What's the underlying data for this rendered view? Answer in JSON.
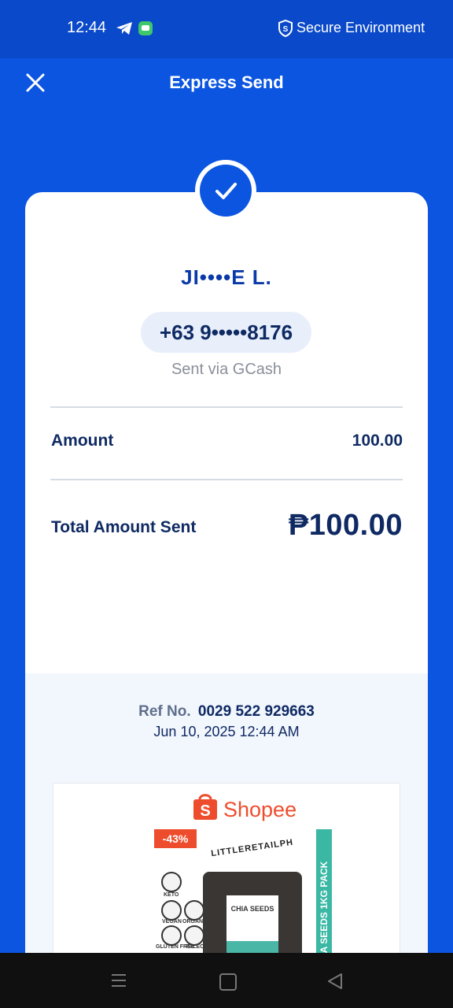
{
  "status_bar": {
    "time": "12:44",
    "secure_text": "Secure Environment"
  },
  "header": {
    "title": "Express Send"
  },
  "receipt": {
    "recipient_name": "JI••••E L.",
    "phone": "+63 9•••••8176",
    "sent_via": "Sent via GCash",
    "amount_label": "Amount",
    "amount_value": "100.00",
    "total_label": "Total Amount Sent",
    "total_value": "₱100.00",
    "ref_label": "Ref No.",
    "ref_number": "0029 522 929663",
    "date": "Jun 10, 2025 12:44 AM"
  },
  "ad": {
    "brand": "Shopee",
    "discount": "-43%",
    "seller": "LITTLERETAILPH",
    "product_title": "CHIA SEEDS",
    "pack_text": "A SEEDS 1KG PACK",
    "diet_labels": [
      "KETO",
      "VEGAN",
      "ORGANIC",
      "GLUTEN FREE",
      "PALEO"
    ]
  },
  "colors": {
    "brand_blue": "#0b55e0",
    "status_blue": "#0a49c9",
    "navy_text": "#0f2a63",
    "shopee_orange": "#ee4d2d"
  },
  "icons": {
    "status": [
      "telegram-icon",
      "chat-app-icon",
      "shield-icon"
    ],
    "header": [
      "close-icon"
    ],
    "nav": [
      "menu-icon",
      "home-icon",
      "back-icon"
    ]
  }
}
